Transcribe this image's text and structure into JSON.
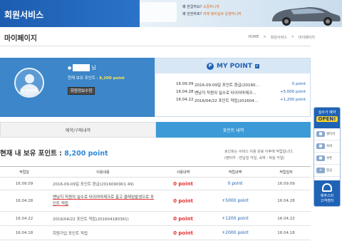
{
  "banner": {
    "service_title": "회원서비스",
    "ad_line1_prefix": "왜 ",
    "ad_line1_text": "한걸까요? ",
    "ad_line1_highlight": "소중하니까",
    "ad_line2_prefix": "왜 ",
    "ad_line2_text": "안전하죠? ",
    "ad_line2_highlight": "자체 정비실로 운영하니까"
  },
  "page": {
    "title": "마이페이지",
    "breadcrumb": [
      "HOME",
      ">",
      "회원서비스",
      ">",
      "마이페이지"
    ]
  },
  "profile": {
    "avatar_caption": "No Images!",
    "name_suffix": "님",
    "current_point_label": "현재 보유 포인트 : ",
    "current_point_value": "8,200 point",
    "edit_button": "회원정보수정"
  },
  "mypoint": {
    "title": "MY POINT",
    "coin_symbol": "P",
    "more_symbol": "+",
    "rows": [
      {
        "date": "16.09.09",
        "desc": "2016-09-09일 포인트 환급(20160…",
        "point": "0 point"
      },
      {
        "date": "16.04.28",
        "desc": "벤남지 직원의 실수로 타이어마제크…",
        "point": "+5,000 point"
      },
      {
        "date": "16.04.22",
        "desc": "2016/04/22 포인트 적립(201604…",
        "point": "+1,200 point"
      }
    ]
  },
  "quick_menu": {
    "top_label": "실수가 예약",
    "open_label": "OPEN!",
    "items": [
      {
        "icon": "car-icon",
        "label": "렌터카"
      },
      {
        "icon": "hotel-icon",
        "label": "숙박"
      },
      {
        "icon": "ticket-icon",
        "label": "쿠폰"
      },
      {
        "icon": "plane-icon",
        "label": "항공"
      }
    ],
    "bottom_line1": "제주스타",
    "bottom_line2": "고객센터"
  },
  "tabs": [
    {
      "label": "예약/구매내역",
      "active": false
    },
    {
      "label": "포인트 내역",
      "active": true
    }
  ],
  "points_summary": {
    "label": "현재 내 보유 포인트 : ",
    "value": "8,200 point",
    "note_line1": "포인트는 서비스 이용 완료 이후에 적립됩니다.",
    "note_line2": "(렌터카 : 반납일 익일, 숙박 : 퇴실 익일)"
  },
  "table": {
    "headers": [
      "적립일",
      "이용내용",
      "사용내역",
      "적립내역",
      "적립일자"
    ],
    "rows": [
      {
        "date": "16.09.09",
        "desc": "2016-09-09일 포인트 환급(2016090901 49)",
        "used": "0 point",
        "earned": "0 point",
        "earn_date": "16.09.09"
      },
      {
        "date": "16.04.28",
        "desc": "벤남지 직원의 실수로 타이어마제크로 출고 클레임발생으로 포인트 적립",
        "used": "0 point",
        "earned": "+5000 point",
        "earn_date": "16.04.28"
      },
      {
        "date": "16.04.22",
        "desc": "2016/04/22 포인트 적립(201604180361)",
        "used": "0 point",
        "earned": "+1200 point",
        "earn_date": "16.04.22"
      },
      {
        "date": "16.04.18",
        "desc": "회원가입 포인트 적립",
        "used": "0 point",
        "earned": "+2000 point",
        "earn_date": "16.04.18"
      }
    ]
  },
  "colors": {
    "primary_blue": "#1f63b5",
    "panel_blue": "#3c86c9",
    "tab_active": "#3c9bd6",
    "point_yellow": "#ffe34c",
    "used_red": "#e33434"
  }
}
